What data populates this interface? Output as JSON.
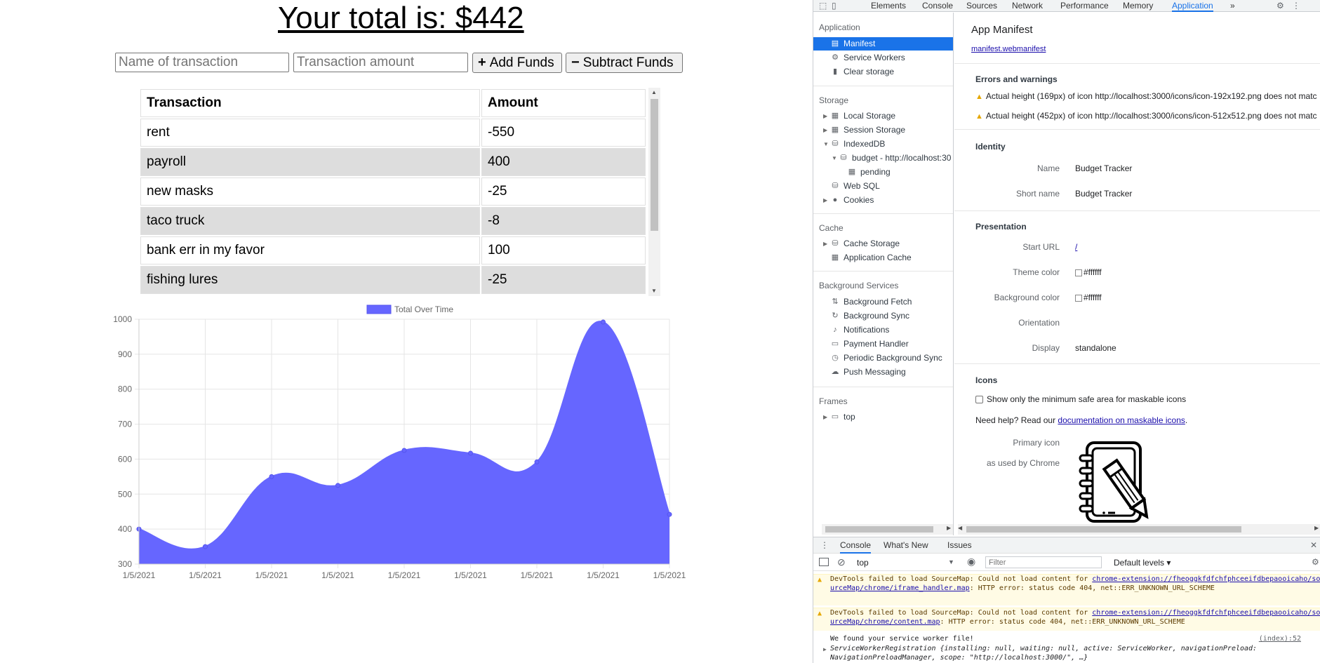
{
  "app": {
    "total_text": "Your total is: $442",
    "name_placeholder": "Name of transaction",
    "amount_placeholder": "Transaction amount",
    "add_label": "Add Funds",
    "subtract_label": "Subtract Funds",
    "table": {
      "headers": [
        "Transaction",
        "Amount"
      ],
      "rows": [
        [
          "rent",
          "-550"
        ],
        [
          "payroll",
          "400"
        ],
        [
          "new masks",
          "-25"
        ],
        [
          "taco truck",
          "-8"
        ],
        [
          "bank err in my favor",
          "100"
        ],
        [
          "fishing lures",
          "-25"
        ]
      ]
    }
  },
  "chart_data": {
    "type": "area",
    "legend": "Total Over Time",
    "legend_placement": "top",
    "categories": [
      "1/5/2021",
      "1/5/2021",
      "1/5/2021",
      "1/5/2021",
      "1/5/2021",
      "1/5/2021",
      "1/5/2021",
      "1/5/2021",
      "1/5/2021"
    ],
    "values": [
      400,
      350,
      550,
      525,
      625,
      617,
      592,
      992,
      442
    ],
    "ylim": [
      300,
      1000
    ],
    "yticks": [
      "1000",
      "900",
      "800",
      "700",
      "600",
      "500",
      "400",
      "300"
    ],
    "ytick_values": [
      1000,
      900,
      800,
      700,
      600,
      500,
      400,
      300
    ],
    "color": "#6666ff",
    "grid": true
  },
  "devtools": {
    "tabs": [
      "Elements",
      "Console",
      "Sources",
      "Network",
      "Performance",
      "Memory",
      "Application"
    ],
    "more": "»",
    "sidebar": {
      "application_header": "Application",
      "manifest": "Manifest",
      "service_workers": "Service Workers",
      "clear_storage": "Clear storage",
      "storage_header": "Storage",
      "local_storage": "Local Storage",
      "session_storage": "Session Storage",
      "indexeddb": "IndexedDB",
      "budget_db": "budget - http://localhost:30",
      "pending": "pending",
      "web_sql": "Web SQL",
      "cookies": "Cookies",
      "cache_header": "Cache",
      "cache_storage": "Cache Storage",
      "application_cache": "Application Cache",
      "bg_header": "Background Services",
      "bg_fetch": "Background Fetch",
      "bg_sync": "Background Sync",
      "notifications": "Notifications",
      "payment_handler": "Payment Handler",
      "periodic_sync": "Periodic Background Sync",
      "push_messaging": "Push Messaging",
      "frames_header": "Frames",
      "top": "top"
    },
    "manifest": {
      "title": "App Manifest",
      "link": "manifest.webmanifest",
      "errors_header": "Errors and warnings",
      "warning1": "Actual height (169px) of icon http://localhost:3000/icons/icon-192x192.png does not matc",
      "warning2": "Actual height (452px) of icon http://localhost:3000/icons/icon-512x512.png does not matc",
      "identity_header": "Identity",
      "name_label": "Name",
      "name_value": "Budget Tracker",
      "short_name_label": "Short name",
      "short_name_value": "Budget Tracker",
      "presentation_header": "Presentation",
      "start_url_label": "Start URL",
      "start_url_value": "/",
      "theme_color_label": "Theme color",
      "theme_color_value": "#ffffff",
      "bg_color_label": "Background color",
      "bg_color_value": "#ffffff",
      "orientation_label": "Orientation",
      "display_label": "Display",
      "display_value": "standalone",
      "icons_header": "Icons",
      "maskable_checkbox": "Show only the minimum safe area for maskable icons",
      "help_prefix": "Need help? Read our ",
      "help_link": "documentation on maskable icons",
      "help_suffix": ".",
      "primary_icon_label": "Primary icon",
      "primary_icon_sub": "as used by Chrome"
    },
    "console": {
      "tabs": [
        "Console",
        "What's New",
        "Issues"
      ],
      "context": "top",
      "filter_placeholder": "Filter",
      "levels": "Default levels ▾",
      "msg1_a": "DevTools failed to load SourceMap: Could not load content for ",
      "msg1_link": "chrome-extension://fheoggkfdfchfphceeifdbepaooicaho/sourceMap/chrome/iframe_handler.map",
      "msg1_b": ": HTTP error: status code 404, net::ERR_UNKNOWN_URL_SCHEME",
      "msg2_a": "DevTools failed to load SourceMap: Could not load content for ",
      "msg2_link": "chrome-extension://fheoggkfdfchfphceeifdbepaooicaho/sourceMap/chrome/content.map",
      "msg2_b": ": HTTP error: status code 404, net::ERR_UNKNOWN_URL_SCHEME",
      "msg3": "We found your service worker file!",
      "msg3_src": "(index):52",
      "msg4": "ServiceWorkerRegistration {installing: null, waiting: null, active: ServiceWorker, navigationPreload: NavigationPreloadManager, scope: \"http://localhost:3000/\", …}"
    }
  }
}
